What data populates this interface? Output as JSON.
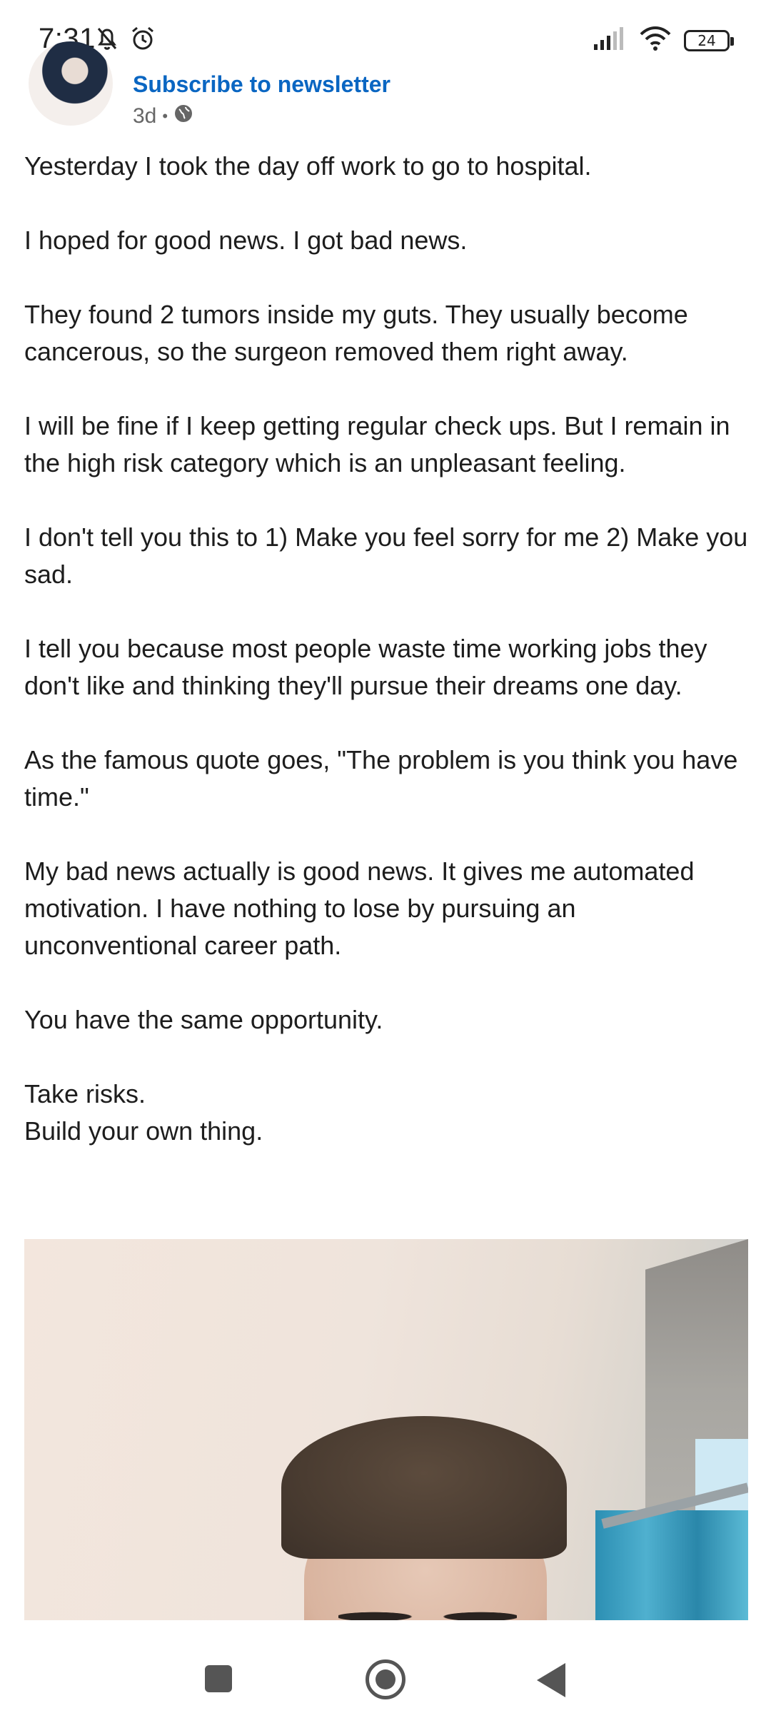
{
  "status_bar": {
    "time": "7:31",
    "battery": "24",
    "icons": [
      "bell-off-icon",
      "alarm-icon",
      "signal-icon",
      "wifi-icon",
      "battery-icon"
    ]
  },
  "post": {
    "subscribe_label": "Subscribe to newsletter",
    "age": "3d",
    "separator": "•",
    "visibility_icon": "globe-icon",
    "paragraphs": [
      "Yesterday I took the day off work to go to hospital.",
      "I hoped for good news. I got bad news.",
      "They found 2 tumors inside my guts. They usually become cancerous, so the surgeon removed them right away.",
      "I will be fine if I keep getting regular check ups. But I remain in the high risk category which is an unpleasant feeling.",
      "I don't tell you this to 1) Make you feel sorry for me 2) Make you sad.",
      "I tell you because most people waste time working jobs they don't like and thinking they'll pursue their dreams one day.",
      "As the famous quote goes, \"The problem is you think you have time.\"",
      "My bad news actually is good news. It gives me automated motivation. I have nothing to lose by pursuing an unconventional career path.",
      "You have the same opportunity.",
      "Take risks.",
      "Build your own thing."
    ]
  },
  "nav_bar": {
    "icons": [
      "recents-icon",
      "home-icon",
      "back-icon"
    ]
  },
  "colors": {
    "link": "#0a66c2",
    "text": "#1d1d1d",
    "meta": "#666666"
  }
}
